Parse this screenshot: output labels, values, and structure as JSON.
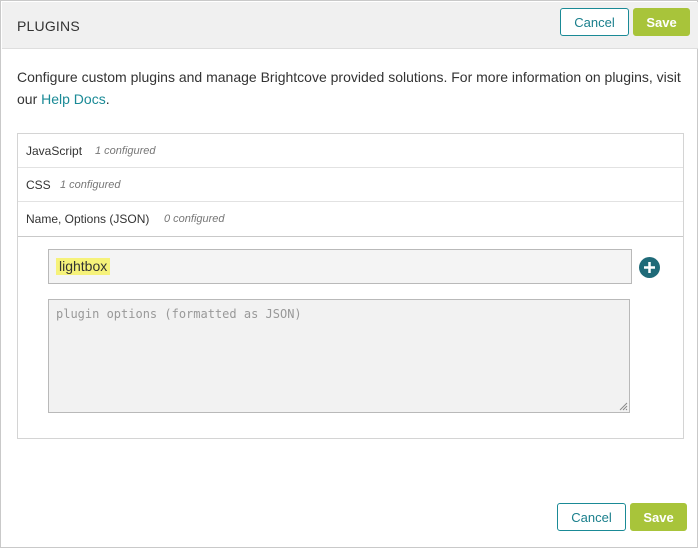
{
  "header": {
    "title": "PLUGINS",
    "cancel_label": "Cancel",
    "save_label": "Save"
  },
  "intro": {
    "text": "Configure custom plugins and manage Brightcove provided solutions. For more information on plugins, visit our ",
    "link_text": "Help Docs",
    "trailing": "."
  },
  "sections": [
    {
      "label": "JavaScript",
      "count": "1 configured"
    },
    {
      "label": "CSS",
      "count": "1 configured"
    },
    {
      "label": "Name, Options (JSON)",
      "count": "0 configured"
    }
  ],
  "plugin_form": {
    "name_value": "lightbox",
    "options_placeholder": "plugin options (formatted as JSON)",
    "add_icon": "plus-circle-icon"
  },
  "footer": {
    "cancel_label": "Cancel",
    "save_label": "Save"
  },
  "colors": {
    "accent_teal": "#1a8a96",
    "save_green": "#a8c43a",
    "highlight": "#f6f27a"
  }
}
